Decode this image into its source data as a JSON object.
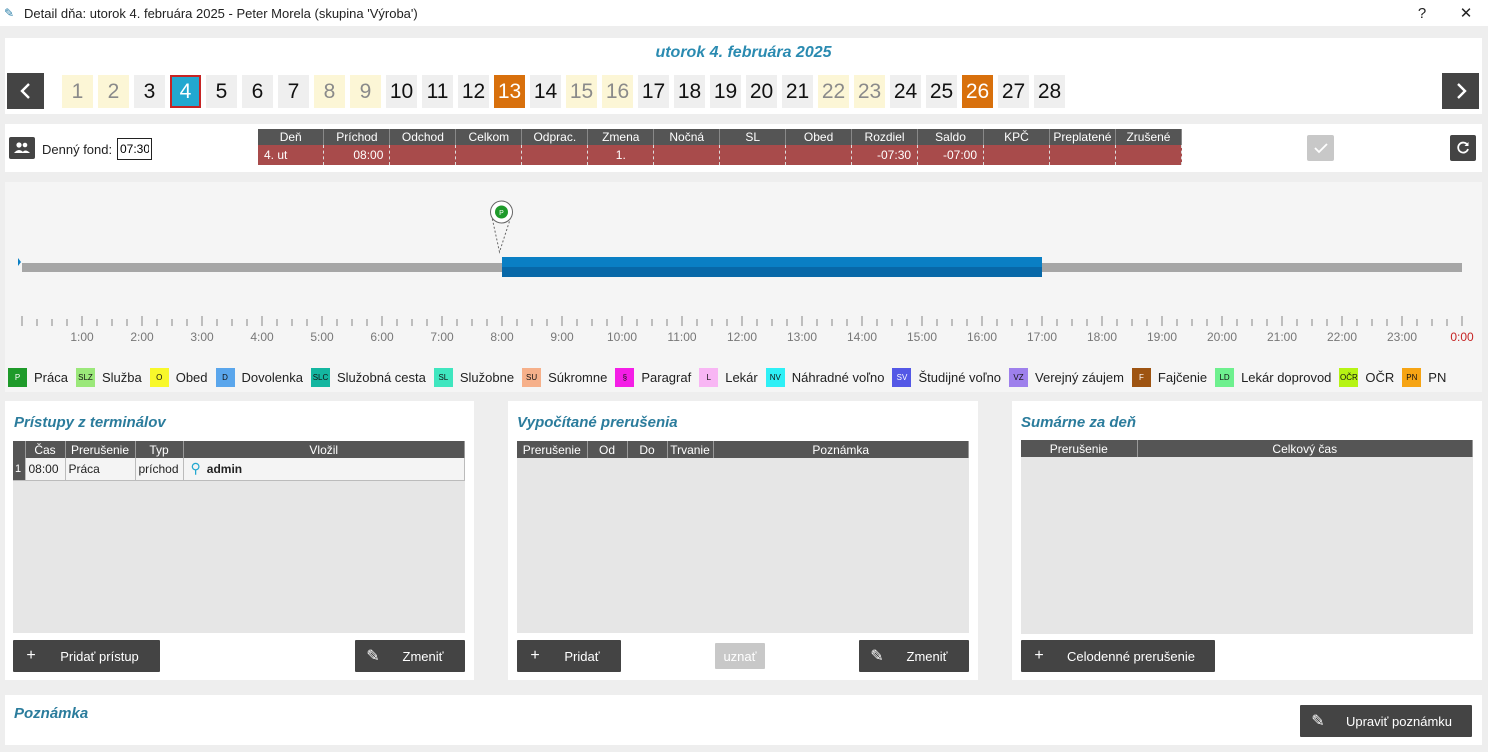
{
  "window": {
    "title": "Detail dňa: utorok 4. februára 2025 -  Peter  Morela  (skupina 'Výroba')",
    "help": "?",
    "close": "✕"
  },
  "day_panel": {
    "title": "utorok 4. februára 2025",
    "days": [
      {
        "n": "1",
        "kind": "we"
      },
      {
        "n": "2",
        "kind": "we"
      },
      {
        "n": "3",
        "kind": ""
      },
      {
        "n": "4",
        "kind": "sel"
      },
      {
        "n": "5",
        "kind": ""
      },
      {
        "n": "6",
        "kind": ""
      },
      {
        "n": "7",
        "kind": ""
      },
      {
        "n": "8",
        "kind": "we"
      },
      {
        "n": "9",
        "kind": "we"
      },
      {
        "n": "10",
        "kind": ""
      },
      {
        "n": "11",
        "kind": ""
      },
      {
        "n": "12",
        "kind": ""
      },
      {
        "n": "13",
        "kind": "hol"
      },
      {
        "n": "14",
        "kind": ""
      },
      {
        "n": "15",
        "kind": "we"
      },
      {
        "n": "16",
        "kind": "we"
      },
      {
        "n": "17",
        "kind": ""
      },
      {
        "n": "18",
        "kind": ""
      },
      {
        "n": "19",
        "kind": ""
      },
      {
        "n": "20",
        "kind": ""
      },
      {
        "n": "21",
        "kind": ""
      },
      {
        "n": "22",
        "kind": "we"
      },
      {
        "n": "23",
        "kind": "we"
      },
      {
        "n": "24",
        "kind": ""
      },
      {
        "n": "25",
        "kind": ""
      },
      {
        "n": "26",
        "kind": "hol"
      },
      {
        "n": "27",
        "kind": ""
      },
      {
        "n": "28",
        "kind": ""
      }
    ]
  },
  "fond": {
    "label": "Denný fond:",
    "value": "07:30",
    "headers": [
      "Deň",
      "Príchod",
      "Odchod",
      "Celkom",
      "Odprac.",
      "Zmena",
      "Nočná",
      "SL",
      "Obed",
      "Rozdiel",
      "Saldo",
      "KPČ",
      "Preplatené",
      "Zrušené"
    ],
    "row": [
      "4. ut",
      "08:00",
      "",
      "",
      "",
      "1.",
      "",
      "",
      "",
      "-07:30",
      "-07:00",
      "",
      "",
      ""
    ]
  },
  "timeline": {
    "hours": [
      "1:00",
      "2:00",
      "3:00",
      "4:00",
      "5:00",
      "6:00",
      "7:00",
      "8:00",
      "9:00",
      "10:00",
      "11:00",
      "12:00",
      "13:00",
      "14:00",
      "15:00",
      "16:00",
      "17:00",
      "18:00",
      "19:00",
      "20:00",
      "21:00",
      "22:00",
      "23:00",
      "0:00"
    ],
    "work_from_hour": 8,
    "work_to_hour": 17,
    "pin_hour": 8,
    "pin_label": "P",
    "bar_color": "#0a7fc4",
    "legend": [
      {
        "code": "P",
        "label": "Práca",
        "color": "#1e9a2a",
        "fg": "#fff"
      },
      {
        "code": "SLZ",
        "label": "Služba",
        "color": "#9be87a",
        "fg": "#111"
      },
      {
        "code": "O",
        "label": "Obed",
        "color": "#f8f82a",
        "fg": "#111"
      },
      {
        "code": "D",
        "label": "Dovolenka",
        "color": "#5aa6ec",
        "fg": "#111"
      },
      {
        "code": "SLC",
        "label": "Služobná cesta",
        "color": "#14b6a0",
        "fg": "#111"
      },
      {
        "code": "SL",
        "label": "Služobne",
        "color": "#3fe6bf",
        "fg": "#111"
      },
      {
        "code": "SU",
        "label": "Súkromne",
        "color": "#f6b08a",
        "fg": "#111"
      },
      {
        "code": "§",
        "label": "Paragraf",
        "color": "#f41ee6",
        "fg": "#111"
      },
      {
        "code": "L",
        "label": "Lekár",
        "color": "#f8b6f4",
        "fg": "#111"
      },
      {
        "code": "NV",
        "label": "Náhradné voľno",
        "color": "#2ef0f6",
        "fg": "#111"
      },
      {
        "code": "SV",
        "label": "Študijné voľno",
        "color": "#5458e6",
        "fg": "#fff"
      },
      {
        "code": "VZ",
        "label": "Verejný záujem",
        "color": "#9e80ec",
        "fg": "#111"
      },
      {
        "code": "F",
        "label": "Fajčenie",
        "color": "#9e5412",
        "fg": "#fff"
      },
      {
        "code": "LD",
        "label": "Lekár doprovod",
        "color": "#6ef08e",
        "fg": "#111"
      },
      {
        "code": "OČR",
        "label": "OČR",
        "color": "#b6f414",
        "fg": "#111"
      },
      {
        "code": "PN",
        "label": "PN",
        "color": "#f6a414",
        "fg": "#111"
      }
    ]
  },
  "pristupy": {
    "title": "Prístupy z terminálov",
    "headers": [
      "",
      "Čas",
      "Prerušenie",
      "Typ",
      "Vložil"
    ],
    "rows": [
      [
        "1",
        "08:00",
        "Práca",
        "príchod",
        "admin"
      ]
    ],
    "add": "Pridať prístup",
    "edit": "Zmeniť"
  },
  "vypocitane": {
    "title": "Vypočítané prerušenia",
    "headers": [
      "Prerušenie",
      "Od",
      "Do",
      "Trvanie",
      "Poznámka"
    ],
    "add": "Pridať",
    "approve": "uznať",
    "edit": "Zmeniť"
  },
  "sumarne": {
    "title": "Sumárne za deň",
    "headers": [
      "Prerušenie",
      "Celkový čas"
    ],
    "add": "Celodenné prerušenie"
  },
  "note": {
    "title": "Poznámka",
    "edit": "Upraviť poznámku"
  }
}
